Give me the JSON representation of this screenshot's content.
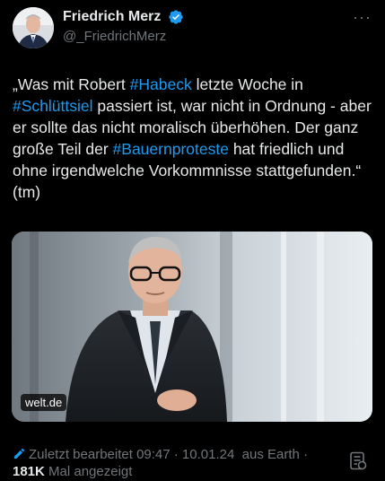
{
  "header": {
    "display_name": "Friedrich Merz",
    "handle": "@_FriedrichMerz",
    "verified_icon": "verified-badge-icon",
    "more_icon": "more-dots-icon",
    "more_label": "···"
  },
  "tweet": {
    "segments": {
      "s1": "„Was mit Robert ",
      "h1": "#Habeck",
      "s2": " letzte Woche in ",
      "h2": "#Schlüttsiel",
      "s3": " passiert ist, war nicht in Ordnung - aber er sollte das nicht moralisch überhöhen. Der ganz große Teil der ",
      "h3": "#Bauernproteste",
      "s4": " hat friedlich und ohne  irgendwelche Vorkommnisse stattgefunden.“ (tm)"
    }
  },
  "media": {
    "source_badge": "welt.de"
  },
  "meta": {
    "edited_label": "Zuletzt bearbeitet 09:47 · 10.01.24",
    "location": "aus Earth",
    "separator": "·",
    "views_count": "181K",
    "views_label": "Mal angezeigt",
    "edit_icon": "pencil-edit-icon",
    "analytics_icon": "analytics-icon"
  },
  "colors": {
    "background": "#000000",
    "text": "#e7e9ea",
    "secondary": "#71767b",
    "accent": "#1d9bf0"
  }
}
